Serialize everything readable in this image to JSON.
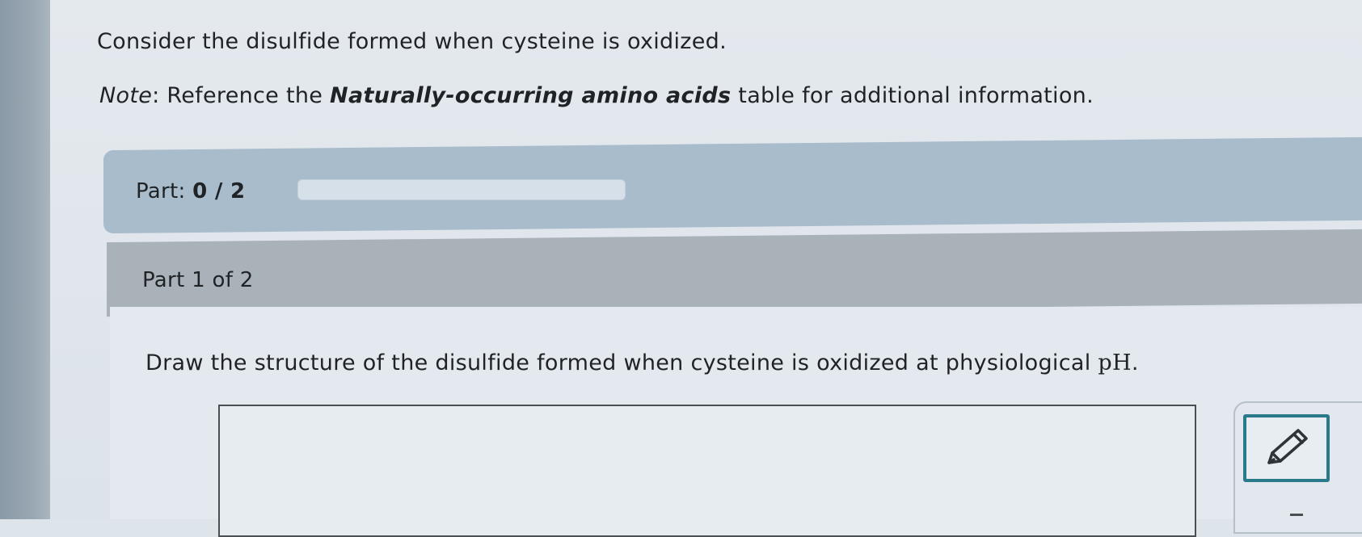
{
  "question": {
    "text": "Consider the disulfide formed when cysteine is oxidized."
  },
  "note": {
    "label": "Note",
    "separator": ": ",
    "prefix": "Reference the ",
    "link_text": "Naturally-occurring amino acids",
    "suffix": " table for additional information."
  },
  "progress": {
    "label": "Part: ",
    "value_text": "0 / 2",
    "completed_parts": 0,
    "total_parts": 2,
    "fill_fraction": 0
  },
  "part": {
    "header": "Part 1 of 2",
    "instruction_main": "Draw the structure of the disulfide formed when cysteine is oxidized at physiological ",
    "instruction_ph": "pH",
    "instruction_end": "."
  },
  "tools": {
    "draw_icon": "pencil-icon"
  },
  "colors": {
    "accent": "#2a7a8c",
    "progress_band": "#a9bccc",
    "part_header": "#aab2b9"
  }
}
